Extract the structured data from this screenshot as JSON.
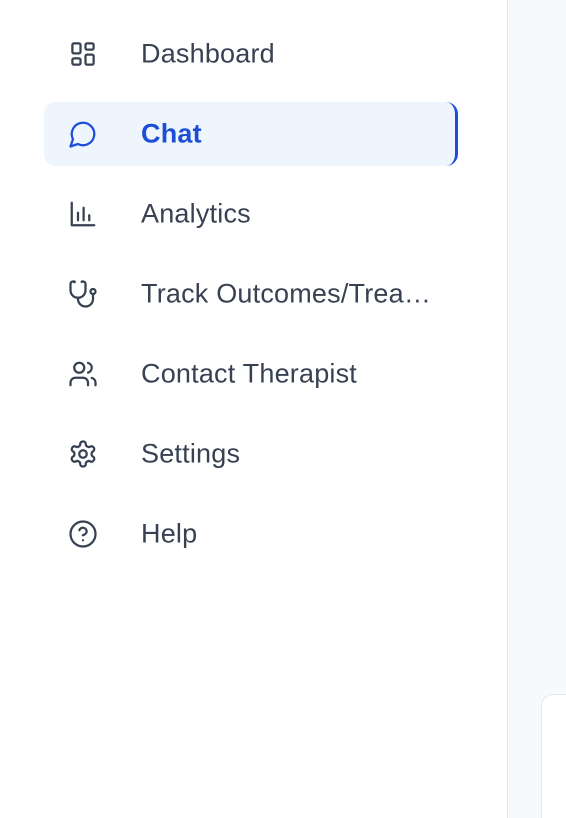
{
  "sidebar": {
    "items": [
      {
        "label": "Dashboard",
        "icon": "dashboard-icon",
        "active": false
      },
      {
        "label": "Chat",
        "icon": "chat-icon",
        "active": true
      },
      {
        "label": "Analytics",
        "icon": "analytics-icon",
        "active": false
      },
      {
        "label": "Track Outcomes/Treatment",
        "icon": "stethoscope-icon",
        "active": false
      },
      {
        "label": "Contact Therapist",
        "icon": "users-icon",
        "active": false
      },
      {
        "label": "Settings",
        "icon": "gear-icon",
        "active": false
      },
      {
        "label": "Help",
        "icon": "help-icon",
        "active": false
      }
    ]
  },
  "colors": {
    "accent": "#1d4ed8",
    "active_bg": "#eff5fd",
    "text": "#374151",
    "divider": "#e5e7eb",
    "main_bg": "#f8f9fb"
  }
}
